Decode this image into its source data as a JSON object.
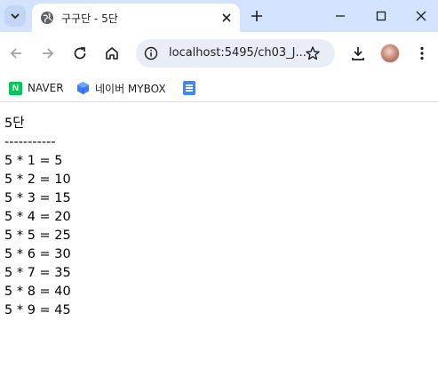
{
  "browser": {
    "tab": {
      "title": "구구단 - 5단",
      "favicon": "globe-icon"
    },
    "omnibox": {
      "url": "localhost:5495/ch03_J..."
    },
    "bookmarks": [
      {
        "label": "NAVER",
        "icon": "naver-icon"
      },
      {
        "label": "네이버 MYBOX",
        "icon": "mybox-icon"
      },
      {
        "label": "",
        "icon": "docs-icon"
      }
    ]
  },
  "page": {
    "heading": "5단",
    "divider": "-----------",
    "rows": [
      "5 * 1 = 5",
      "5 * 2 = 10",
      "5 * 3 = 15",
      "5 * 4 = 20",
      "5 * 5 = 25",
      "5 * 6 = 30",
      "5 * 7 = 35",
      "5 * 8 = 40",
      "5 * 9 = 45"
    ]
  }
}
